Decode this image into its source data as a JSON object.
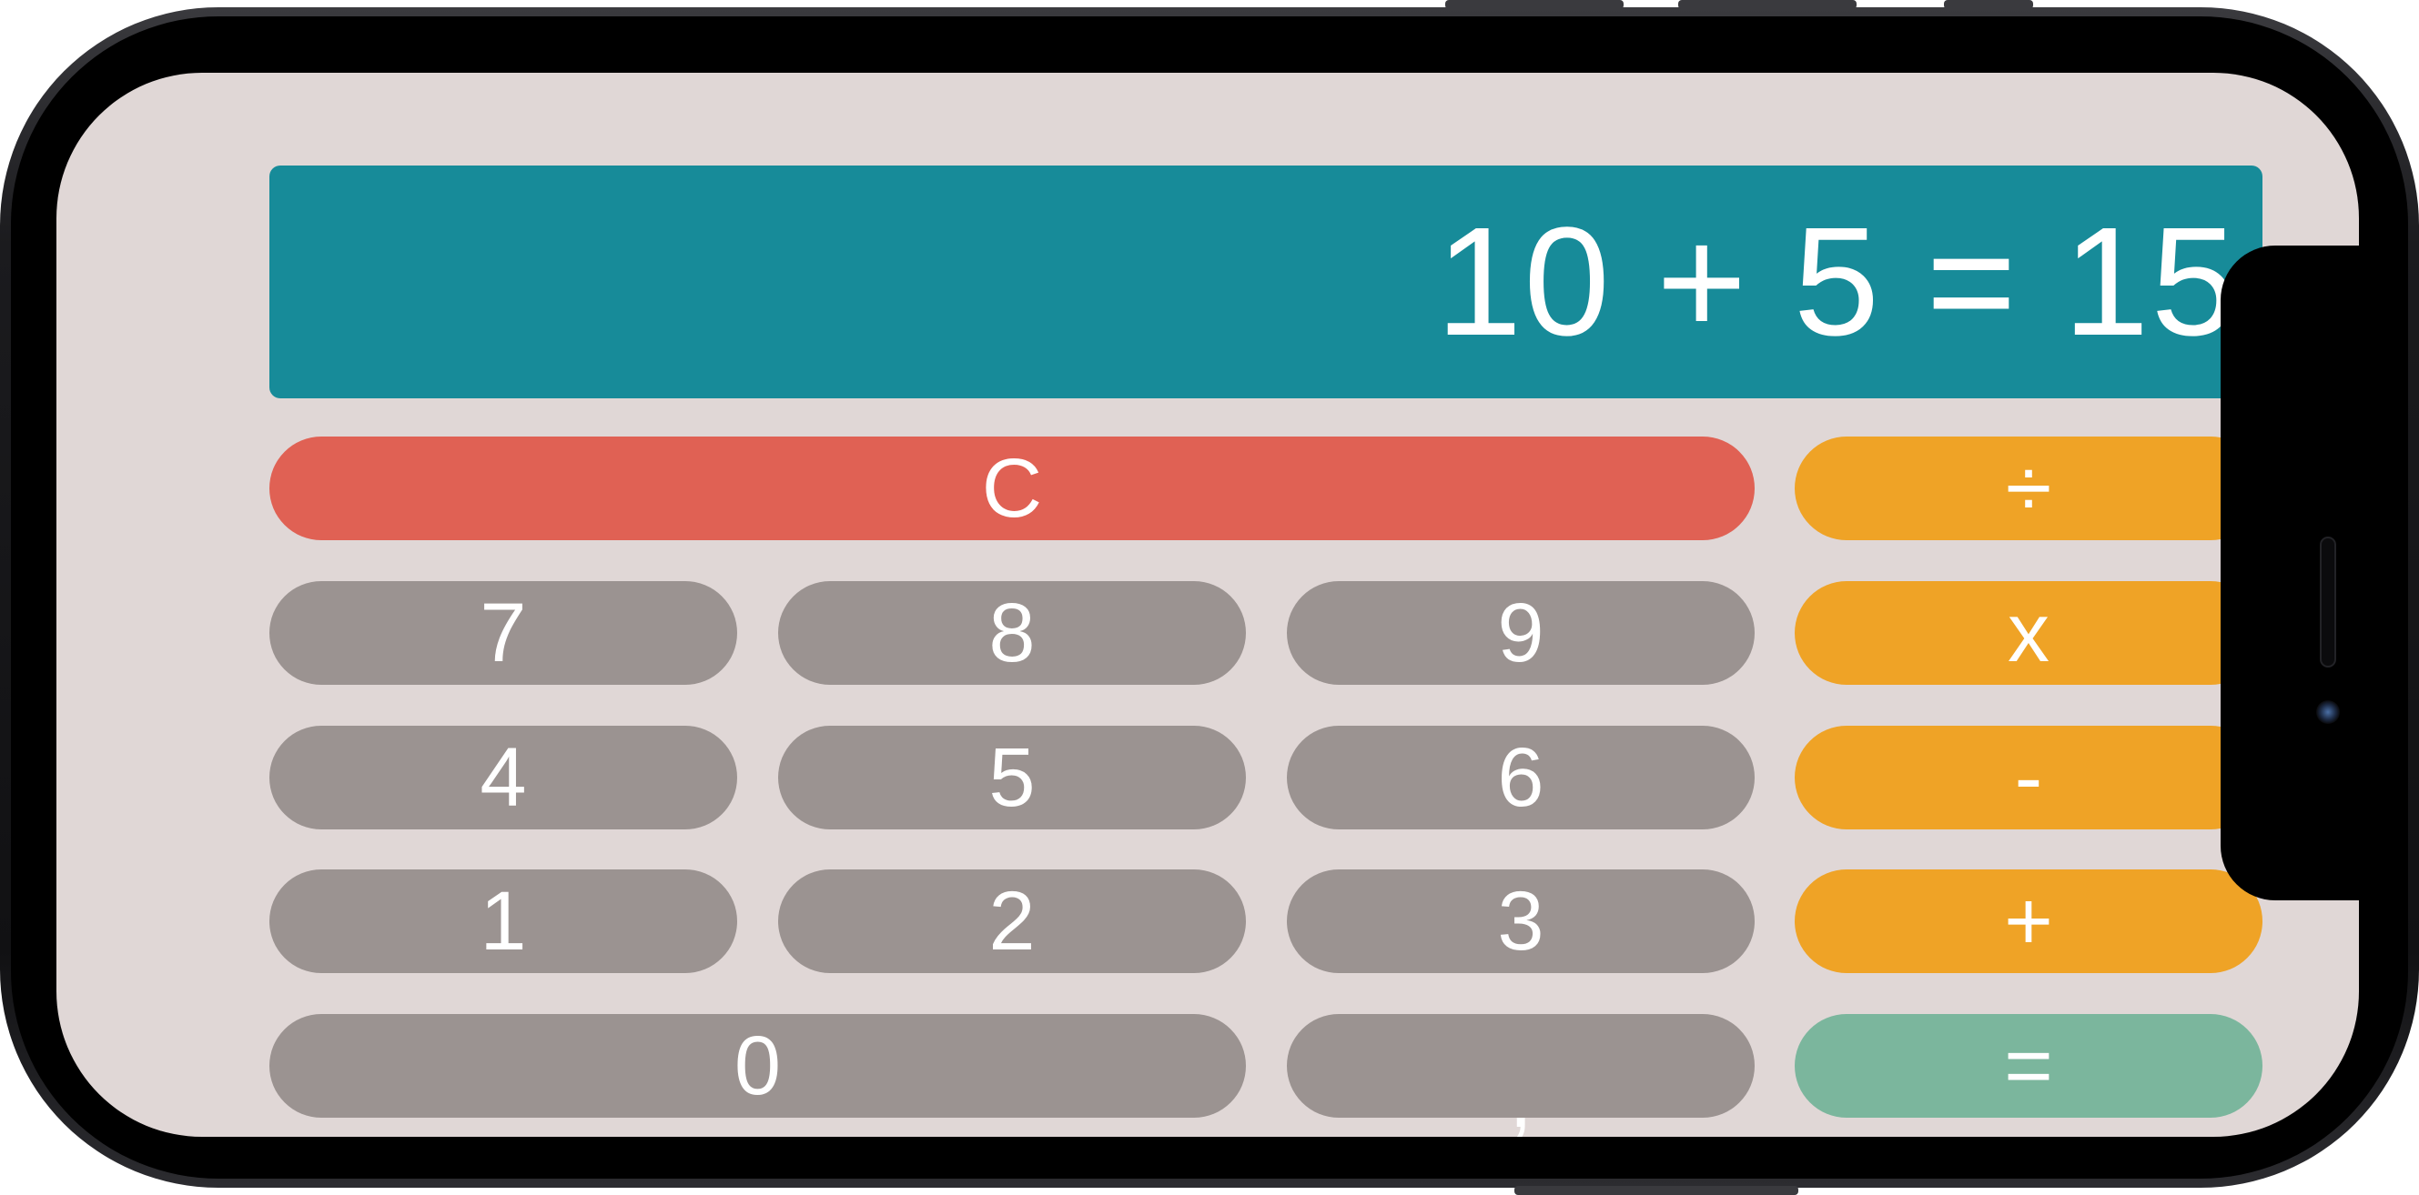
{
  "display": {
    "expression": "10 + 5 = 15"
  },
  "buttons": {
    "clear": "C",
    "divide": "÷",
    "multiply": "x",
    "subtract": "-",
    "add": "+",
    "equals": "=",
    "seven": "7",
    "eight": "8",
    "nine": "9",
    "four": "4",
    "five": "5",
    "six": "6",
    "one": "1",
    "two": "2",
    "three": "3",
    "zero": "0",
    "comma": ","
  },
  "colors": {
    "display_background": "#178b99",
    "clear_button": "#e06154",
    "number_button": "#9b9391",
    "operator_button": "#efa326",
    "equals_button": "#7bb69d",
    "app_background": "#e0d7d6"
  }
}
